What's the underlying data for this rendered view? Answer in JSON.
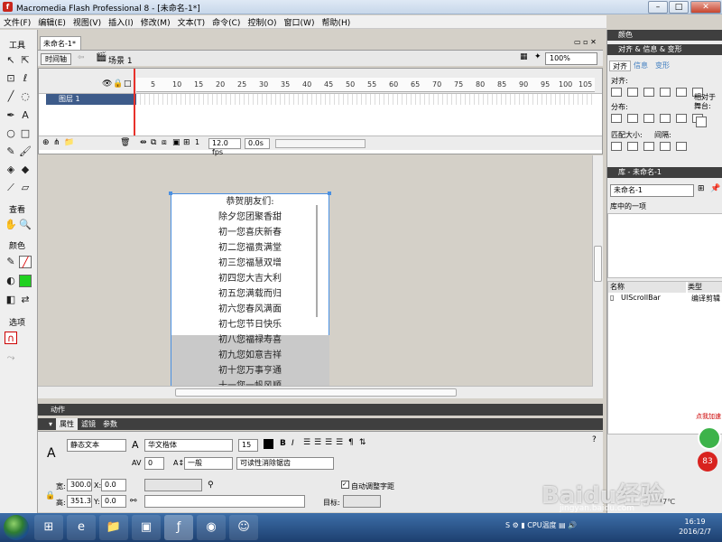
{
  "window": {
    "title": "Macromedia Flash Professional 8 - [未命名-1*]"
  },
  "menu": [
    "文件(F)",
    "编辑(E)",
    "视图(V)",
    "插入(I)",
    "修改(M)",
    "文本(T)",
    "命令(C)",
    "控制(O)",
    "窗口(W)",
    "帮助(H)"
  ],
  "tools": {
    "title": "工具",
    "view_label": "查看",
    "color_label": "颜色",
    "options_label": "选项"
  },
  "document": {
    "tab": "未命名-1*",
    "timeline_button": "时间轴",
    "scene": "场景 1",
    "zoom": "100%"
  },
  "timeline": {
    "ruler": [
      "5",
      "10",
      "15",
      "20",
      "25",
      "30",
      "35",
      "40",
      "45",
      "50",
      "55",
      "60",
      "65",
      "70",
      "75",
      "80",
      "85",
      "90",
      "95",
      "100",
      "105"
    ],
    "layer_name": "图层 1",
    "current_frame": "1",
    "fps": "12.0 fps",
    "time": "0.0s"
  },
  "stage": {
    "lines": [
      "恭贺朋友们:",
      "除夕您团聚香甜",
      "初一您喜庆新春",
      "初二您福贵满堂",
      "初三您福慧双增",
      "初四您大吉大利",
      "初五您满载而归",
      "初六您春风满面",
      "初七您节日快乐",
      "初八您福禄寿喜",
      "初九您如意吉祥",
      "初十您万事亨通",
      "十一您一帆风顺"
    ]
  },
  "panels": {
    "actions": "动作",
    "properties_tabs": [
      "属性",
      "滤镜",
      "参数"
    ],
    "text_type": "静态文本",
    "font": "华文楷体",
    "font_size": "15",
    "letter_spacing": "0",
    "spacing_mode": "一般",
    "render_mode": "可读性消除锯齿",
    "width_label": "宽:",
    "width": "300.0",
    "height_label": "高:",
    "height": "351.3",
    "x_label": "X:",
    "x": "0.0",
    "y_label": "Y:",
    "y": "0.0",
    "auto_kern": "自动调整字距",
    "target_label": "目标:"
  },
  "right": {
    "color_header": "颜色",
    "align_header": "对齐 & 信息 & 变形",
    "align_tabs": [
      "对齐",
      "信息",
      "变形"
    ],
    "align_label": "对齐:",
    "distribute_label": "分布:",
    "match_size_label": "匹配大小:",
    "spacing_label": "间隔:",
    "to_stage_label": "相对于舞台:",
    "library_header": "库 - 未命名-1",
    "library_select": "未命名-1",
    "library_count": "库中的一项",
    "col_name": "名称",
    "col_type": "类型",
    "item_name": "UIScrollBar",
    "item_type": "编译剪辑"
  },
  "taskbar": {
    "time": "16:19",
    "date": "2016/2/7",
    "cpu_label": "CPU温度",
    "temp": "47℃"
  },
  "watermark": {
    "brand": "Baidu经验",
    "url": "jingyan.baidu.com",
    "badge_text": "点我加速",
    "badge_num": "83"
  }
}
